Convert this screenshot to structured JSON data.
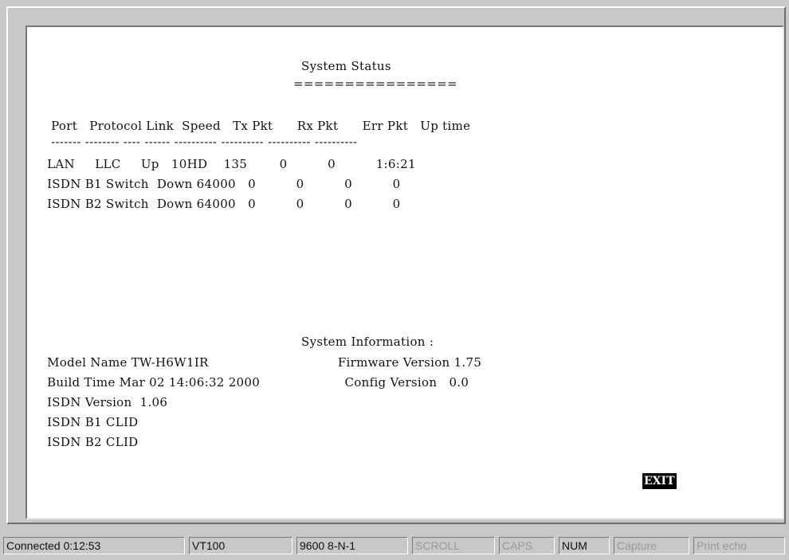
{
  "system_status": {
    "title": "System Status",
    "underline": "================",
    "table_header": "  Port   Protocol Link  Speed   Tx Pkt      Rx Pkt      Err Pkt   Up time",
    "table_separator": "  ------- -------- ---- ------ ---------- ---------- ---------- ----------",
    "columns": [
      "Port",
      "Protocol",
      "Link",
      "Speed",
      "Tx Pkt",
      "Rx Pkt",
      "Err Pkt",
      "Up time"
    ],
    "rows": [
      {
        "port": "LAN",
        "protocol": "LLC",
        "link": "Up",
        "speed": "10HD",
        "tx_pkt": "135",
        "rx_pkt": "0",
        "err_pkt": "0",
        "up_time": "1:6:21",
        "text": " LAN     LLC     Up   10HD    135        0          0          1:6:21"
      },
      {
        "port": "ISDN B1",
        "protocol": "Switch",
        "link": "Down",
        "speed": "64000",
        "tx_pkt": "0",
        "rx_pkt": "0",
        "err_pkt": "0",
        "up_time": "0",
        "text": " ISDN B1 Switch  Down 64000   0          0          0          0"
      },
      {
        "port": "ISDN B2",
        "protocol": "Switch",
        "link": "Down",
        "speed": "64000",
        "tx_pkt": "0",
        "rx_pkt": "0",
        "err_pkt": "0",
        "up_time": "0",
        "text": " ISDN B2 Switch  Down 64000   0          0          0          0"
      }
    ]
  },
  "system_information": {
    "title": "System Information :",
    "line1": " Model Name TW-H6W1IR                                Firmware Version 1.75",
    "line2": " Build Time Mar 02 14:06:32 2000                     Config Version   0.0",
    "line3": " ISDN Version  1.06",
    "line4": " ISDN B1 CLID",
    "line5": " ISDN B2 CLID",
    "model_name": "TW-H6W1IR",
    "build_time": "Mar 02 14:06:32 2000",
    "isdn_version": "1.06",
    "firmware_version": "1.75",
    "config_version": "0.0"
  },
  "exit_label": "EXIT",
  "statusbar": {
    "connected": "Connected 0:12:53",
    "emulation": "VT100",
    "port_settings": "9600 8-N-1",
    "scroll": "SCROLL",
    "caps": "CAPS",
    "num": "NUM",
    "capture": "Capture",
    "print_echo": "Print echo"
  }
}
